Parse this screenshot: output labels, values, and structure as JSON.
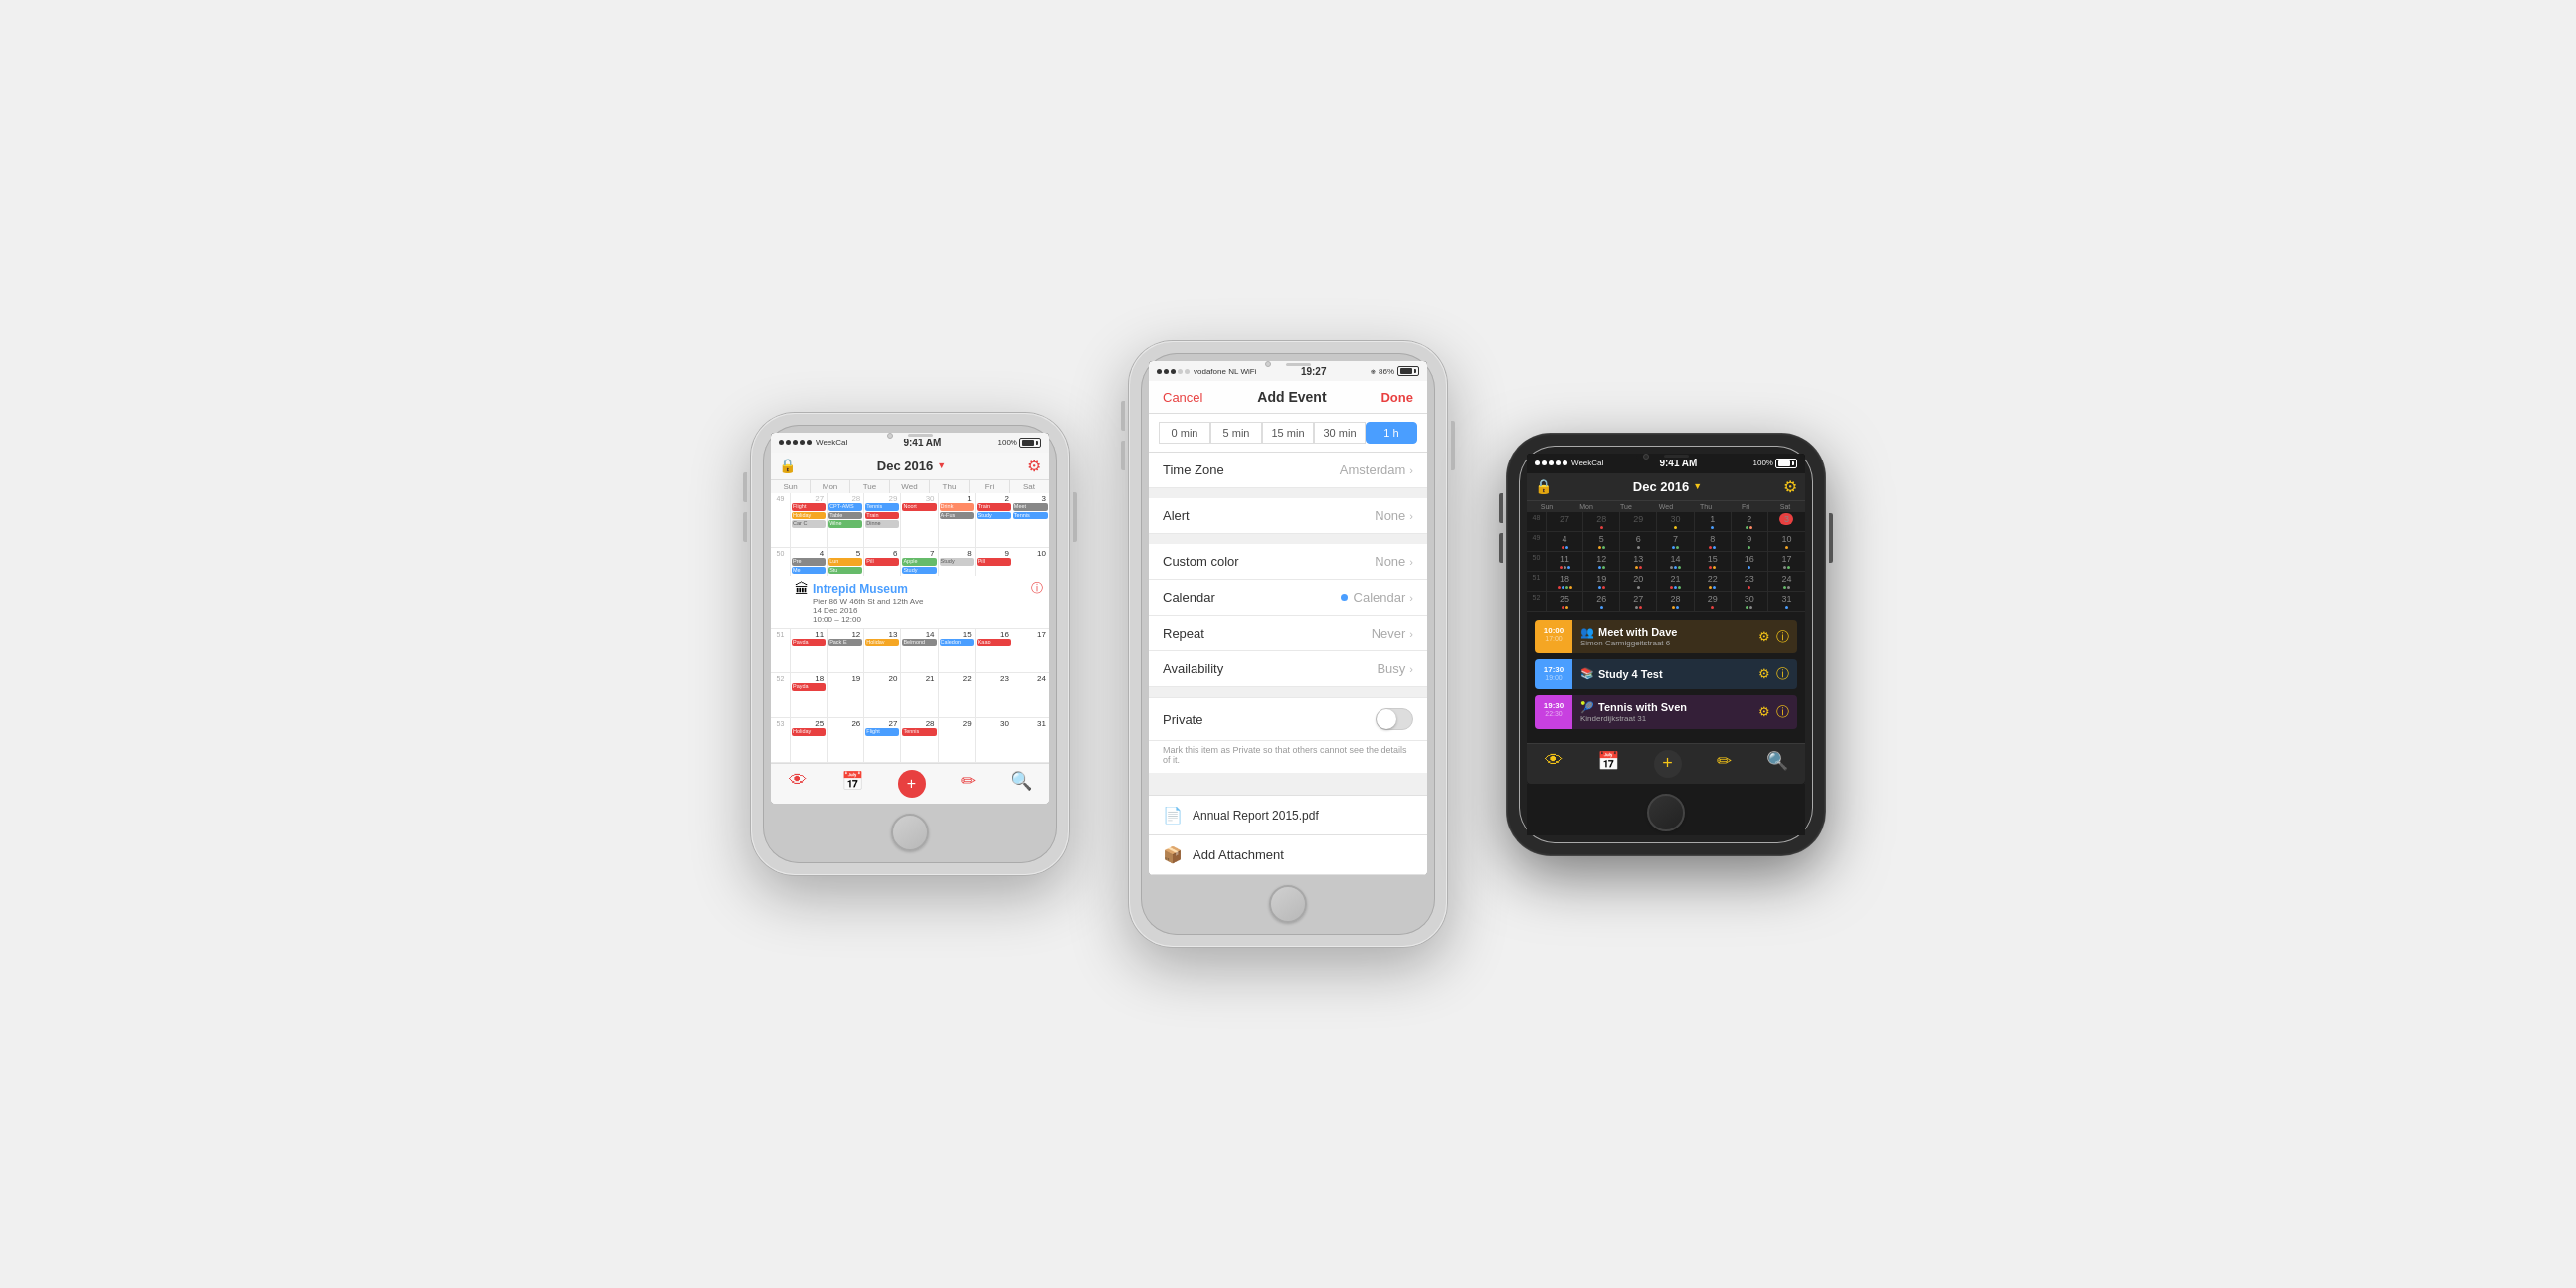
{
  "phones": {
    "phone1": {
      "status_left": "WeekCal",
      "status_time": "9:41 AM",
      "status_right": "100%",
      "month_title": "Dec 2016",
      "days_of_week": [
        "Sun",
        "Mon",
        "Tue",
        "Wed",
        "Thu",
        "Fri",
        "Sat"
      ],
      "lock_icon": "🔒",
      "gear_icon": "⚙",
      "bottom_icons": [
        "👁",
        "📅",
        "+",
        "✏",
        "🔍"
      ],
      "expanded_event": {
        "icon": "🏛",
        "name": "Intrepid Museum",
        "location": "Pier 86 W 46th St and 12th Ave",
        "date": "14 Dec 2016",
        "time": "10:00 – 12:00"
      }
    },
    "phone2": {
      "status_left": "vodafone NL",
      "status_wifi": "WiFi",
      "status_time": "19:27",
      "status_bt": "BT",
      "status_right": "86%",
      "nav": {
        "cancel": "Cancel",
        "title": "Add Event",
        "done": "Done"
      },
      "alert_options": [
        "0 min",
        "5 min",
        "15 min",
        "30 min",
        "1 h"
      ],
      "active_alert": "1 h",
      "rows": [
        {
          "label": "Time Zone",
          "value": "Amsterdam"
        },
        {
          "label": "Alert",
          "value": "None"
        },
        {
          "label": "Custom color",
          "value": "None"
        },
        {
          "label": "Calendar",
          "value": "Calendar",
          "has_dot": true
        },
        {
          "label": "Repeat",
          "value": "Never"
        },
        {
          "label": "Availability",
          "value": "Busy"
        }
      ],
      "private_label": "Private",
      "private_hint": "Mark this item as Private so that others cannot see the details of it.",
      "attachment_name": "Annual Report 2015.pdf",
      "add_attachment": "Add Attachment"
    },
    "phone3": {
      "status_left": "WeekCal",
      "status_time": "9:41 AM",
      "status_right": "100%",
      "month_title": "Dec 2016",
      "days_of_week": [
        "Sun",
        "Mon",
        "Tue",
        "Wed",
        "Thu",
        "Fri",
        "Sat"
      ],
      "lock_icon": "🔒",
      "gear_icon": "⚙",
      "weeks": [
        {
          "num": 48,
          "days": [
            27,
            28,
            29,
            30,
            1,
            2,
            3
          ],
          "today_idx": 6
        },
        {
          "num": 49,
          "days": [
            4,
            5,
            6,
            7,
            8,
            9,
            10
          ]
        },
        {
          "num": 50,
          "days": [
            11,
            12,
            13,
            14,
            15,
            16,
            17
          ]
        },
        {
          "num": 51,
          "days": [
            18,
            19,
            20,
            21,
            22,
            23,
            24
          ]
        },
        {
          "num": 52,
          "days": [
            25,
            26,
            27,
            28,
            29,
            30,
            31
          ]
        }
      ],
      "events": [
        {
          "color": "#f5a623",
          "start": "10:00",
          "end": "17:00",
          "icon": "👥",
          "name": "Meet with Dave",
          "location": "Simon Carmiggeitstraat 6"
        },
        {
          "color": "#4a9eff",
          "start": "17:30",
          "end": "19:00",
          "icon": "📚",
          "name": "Study 4 Test",
          "location": ""
        },
        {
          "color": "#c840e0",
          "start": "19:30",
          "end": "22:30",
          "icon": "🎾",
          "name": "Tennis with Sven",
          "location": "Kinderdijkstraat 31"
        }
      ],
      "bottom_icons": [
        "👁",
        "📅",
        "+",
        "✏",
        "🔍"
      ]
    }
  }
}
